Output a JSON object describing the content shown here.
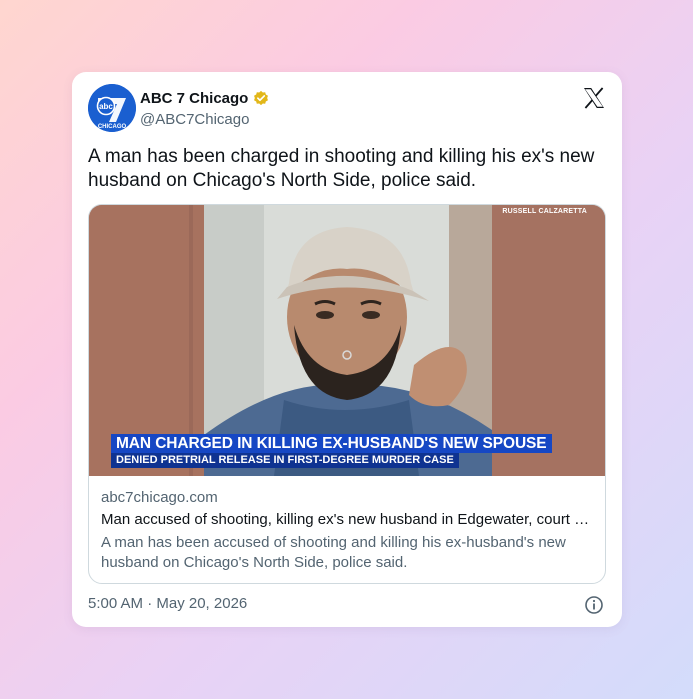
{
  "tweet": {
    "author_name": "ABC 7 Chicago",
    "handle": "@ABC7Chicago",
    "text": "A man has been charged in shooting and killing his ex's new husband on Chicago's North Side, police said.",
    "timestamp": "5:00 AM · May 20, 2026",
    "avatar_logo": {
      "network": "abc",
      "channel": "7",
      "city": "CHICAGO"
    },
    "icons": {
      "verified": "verified-badge-icon",
      "platform": "x-logo-icon",
      "info": "info-icon"
    }
  },
  "link_card": {
    "image_credit": "RUSSELL CALZARETTA",
    "lower_third_main": "MAN CHARGED IN KILLING EX-HUSBAND'S NEW SPOUSE",
    "lower_third_sub": "DENIED PRETRIAL RELEASE IN FIRST-DEGREE MURDER CASE",
    "domain": "abc7chicago.com",
    "headline": "Man accused of shooting, killing ex's new husband in Edgewater, court documents say",
    "description": "A man has been accused of shooting and killing his ex-husband's new husband on Chicago's North Side, police said."
  },
  "colors": {
    "abc_blue": "#1a5fd0",
    "verified_gold": "#e2b719",
    "lower_third_blue": "#1647c4",
    "text_primary": "#0f1419",
    "text_secondary": "#536471",
    "card_border": "#cfd9de"
  }
}
